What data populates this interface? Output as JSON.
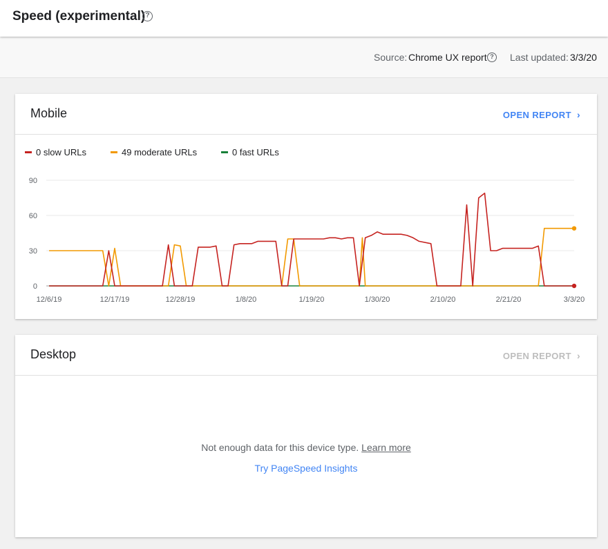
{
  "header": {
    "title": "Speed (experimental)",
    "help_glyph": "?"
  },
  "info": {
    "source_label": "Source:",
    "source_value": "Chrome UX report",
    "help_glyph": "?",
    "updated_label": "Last updated:",
    "updated_value": "3/3/20"
  },
  "mobile": {
    "title": "Mobile",
    "open_report_label": "OPEN REPORT",
    "chevron": "›",
    "legend": [
      {
        "label": "0 slow URLs",
        "color": "#c5221f"
      },
      {
        "label": "49 moderate URLs",
        "color": "#f29900"
      },
      {
        "label": "0 fast URLs",
        "color": "#188038"
      }
    ]
  },
  "desktop": {
    "title": "Desktop",
    "open_report_label": "OPEN REPORT",
    "chevron": "›",
    "empty_text": "Not enough data for this device type.",
    "learn_more": "Learn more",
    "psi_link": "Try PageSpeed Insights"
  },
  "colors": {
    "accent": "#4285f4",
    "slow": "#c5221f",
    "moderate": "#f29900",
    "fast": "#188038"
  },
  "chart_data": {
    "type": "line",
    "x_ticks": [
      "12/6/19",
      "12/17/19",
      "12/28/19",
      "1/8/20",
      "1/19/20",
      "1/30/20",
      "2/10/20",
      "2/21/20",
      "3/3/20"
    ],
    "y_ticks": [
      "0",
      "30",
      "60",
      "90"
    ],
    "ylim": [
      0,
      90
    ],
    "xlim_days": [
      0,
      88
    ],
    "grid": true,
    "legend_position": "top-left",
    "series": [
      {
        "name": "0 slow URLs",
        "color": "#c5221f",
        "points": [
          [
            0,
            0
          ],
          [
            9,
            0
          ],
          [
            10,
            30
          ],
          [
            11,
            0
          ],
          [
            19,
            0
          ],
          [
            20,
            35
          ],
          [
            21,
            0
          ],
          [
            24,
            0
          ],
          [
            25,
            33
          ],
          [
            27,
            33
          ],
          [
            28,
            34
          ],
          [
            29,
            0
          ],
          [
            30,
            0
          ],
          [
            31,
            35
          ],
          [
            32,
            36
          ],
          [
            34,
            36
          ],
          [
            35,
            38
          ],
          [
            38,
            38
          ],
          [
            39,
            0
          ],
          [
            40,
            0
          ],
          [
            41,
            40
          ],
          [
            46,
            40
          ],
          [
            47,
            41
          ],
          [
            48,
            41
          ],
          [
            49,
            40
          ],
          [
            50,
            41
          ],
          [
            51,
            41
          ],
          [
            52,
            0
          ],
          [
            53,
            41
          ],
          [
            54,
            43
          ],
          [
            55,
            46
          ],
          [
            56,
            44
          ],
          [
            59,
            44
          ],
          [
            60,
            43
          ],
          [
            61,
            41
          ],
          [
            62,
            38
          ],
          [
            64,
            36
          ],
          [
            65,
            0
          ],
          [
            69,
            0
          ],
          [
            70,
            69
          ],
          [
            71,
            0
          ],
          [
            72,
            75
          ],
          [
            73,
            79
          ],
          [
            74,
            30
          ],
          [
            75,
            30
          ],
          [
            76,
            32
          ],
          [
            80,
            32
          ],
          [
            81,
            32
          ],
          [
            82,
            34
          ],
          [
            83,
            0
          ],
          [
            88,
            0
          ]
        ]
      },
      {
        "name": "49 moderate URLs",
        "color": "#f29900",
        "points": [
          [
            0,
            30
          ],
          [
            9,
            30
          ],
          [
            10,
            0
          ],
          [
            11,
            32
          ],
          [
            12,
            0
          ],
          [
            20,
            0
          ],
          [
            21,
            35
          ],
          [
            22,
            34
          ],
          [
            23,
            0
          ],
          [
            39,
            0
          ],
          [
            40,
            40
          ],
          [
            41,
            40
          ],
          [
            42,
            0
          ],
          [
            52,
            0
          ],
          [
            52.5,
            41
          ],
          [
            53,
            0
          ],
          [
            82,
            0
          ],
          [
            83,
            49
          ],
          [
            88,
            49
          ]
        ]
      },
      {
        "name": "0 fast URLs",
        "color": "#188038",
        "points": [
          [
            0,
            0
          ],
          [
            88,
            0
          ]
        ]
      }
    ]
  }
}
